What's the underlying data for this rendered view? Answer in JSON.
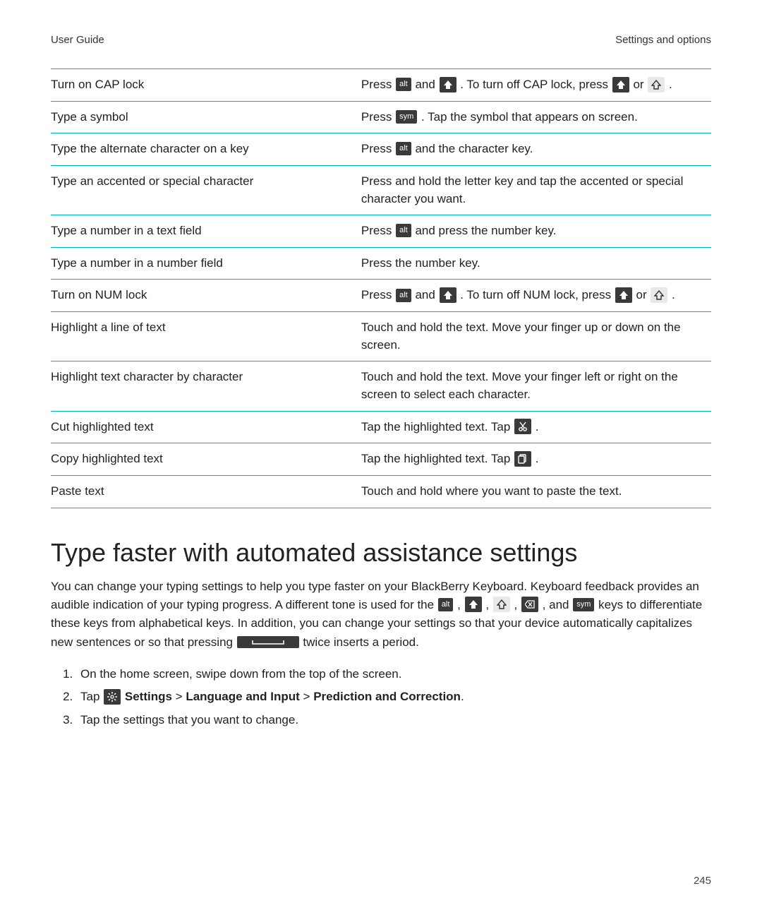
{
  "header": {
    "left": "User Guide",
    "right": "Settings and options"
  },
  "table": {
    "rows": [
      {
        "action": "Turn on CAP lock",
        "parts": [
          {
            "t": "Press "
          },
          {
            "key": "alt"
          },
          {
            "t": " and "
          },
          {
            "key": "shift-up"
          },
          {
            "t": " . To turn off CAP lock, press "
          },
          {
            "key": "shift-up"
          },
          {
            "t": " or "
          },
          {
            "key": "shift-up-hollow"
          },
          {
            "t": " ."
          }
        ]
      },
      {
        "action": "Type a symbol",
        "parts": [
          {
            "t": "Press "
          },
          {
            "key": "sym"
          },
          {
            "t": " . Tap the symbol that appears on screen."
          }
        ]
      },
      {
        "action": "Type the alternate character on a key",
        "parts": [
          {
            "t": "Press "
          },
          {
            "key": "alt"
          },
          {
            "t": " and the character key."
          }
        ]
      },
      {
        "action": "Type an accented or special character",
        "parts": [
          {
            "t": "Press and hold the letter key and tap the accented or special character you want."
          }
        ]
      },
      {
        "action": "Type a number in a text field",
        "parts": [
          {
            "t": "Press "
          },
          {
            "key": "alt"
          },
          {
            "t": " and press the number key."
          }
        ]
      },
      {
        "action": "Type a number in a number field",
        "parts": [
          {
            "t": "Press the number key."
          }
        ]
      },
      {
        "action": "Turn on NUM lock",
        "parts": [
          {
            "t": "Press "
          },
          {
            "key": "alt"
          },
          {
            "t": " and "
          },
          {
            "key": "shift-up"
          },
          {
            "t": " . To turn off NUM lock, press "
          },
          {
            "key": "shift-up"
          },
          {
            "t": " or "
          },
          {
            "key": "shift-up-hollow"
          },
          {
            "t": " ."
          }
        ]
      },
      {
        "action": "Highlight a line of text",
        "parts": [
          {
            "t": "Touch and hold the text. Move your finger up or down on the screen."
          }
        ]
      },
      {
        "action": "Highlight text character by character",
        "parts": [
          {
            "t": "Touch and hold the text. Move your finger left or right on the screen to select each character."
          }
        ]
      },
      {
        "action": "Cut highlighted text",
        "parts": [
          {
            "t": "Tap the highlighted text. Tap "
          },
          {
            "key": "cut"
          },
          {
            "t": " ."
          }
        ]
      },
      {
        "action": "Copy highlighted text",
        "parts": [
          {
            "t": "Tap the highlighted text. Tap "
          },
          {
            "key": "copy"
          },
          {
            "t": " ."
          }
        ]
      },
      {
        "action": "Paste text",
        "parts": [
          {
            "t": "Touch and hold where you want to paste the text."
          }
        ]
      }
    ]
  },
  "section": {
    "title": "Type faster with automated assistance settings",
    "para_parts": [
      {
        "t": "You can change your typing settings to help you type faster on your BlackBerry Keyboard. Keyboard feedback provides an audible indication of your typing progress. A different tone is used for the "
      },
      {
        "key": "alt"
      },
      {
        "t": " , "
      },
      {
        "key": "shift-up"
      },
      {
        "t": " , "
      },
      {
        "key": "shift-up-hollow"
      },
      {
        "t": " , "
      },
      {
        "key": "delete"
      },
      {
        "t": " , and "
      },
      {
        "key": "sym"
      },
      {
        "t": " keys to differentiate these keys from alphabetical keys. In addition, you can change your settings so that your device automatically capitalizes new sentences or so that pressing "
      },
      {
        "key": "space",
        "wide": true
      },
      {
        "t": " twice inserts a period."
      }
    ],
    "steps": [
      {
        "parts": [
          {
            "t": "On the home screen, swipe down from the top of the screen."
          }
        ]
      },
      {
        "parts": [
          {
            "t": "Tap "
          },
          {
            "key": "settings"
          },
          {
            "t": " "
          },
          {
            "bold": "Settings"
          },
          {
            "t": " > "
          },
          {
            "bold": "Language and Input"
          },
          {
            "t": " > "
          },
          {
            "bold": "Prediction and Correction"
          },
          {
            "t": "."
          }
        ]
      },
      {
        "parts": [
          {
            "t": "Tap the settings that you want to change."
          }
        ]
      }
    ]
  },
  "page_number": "245"
}
